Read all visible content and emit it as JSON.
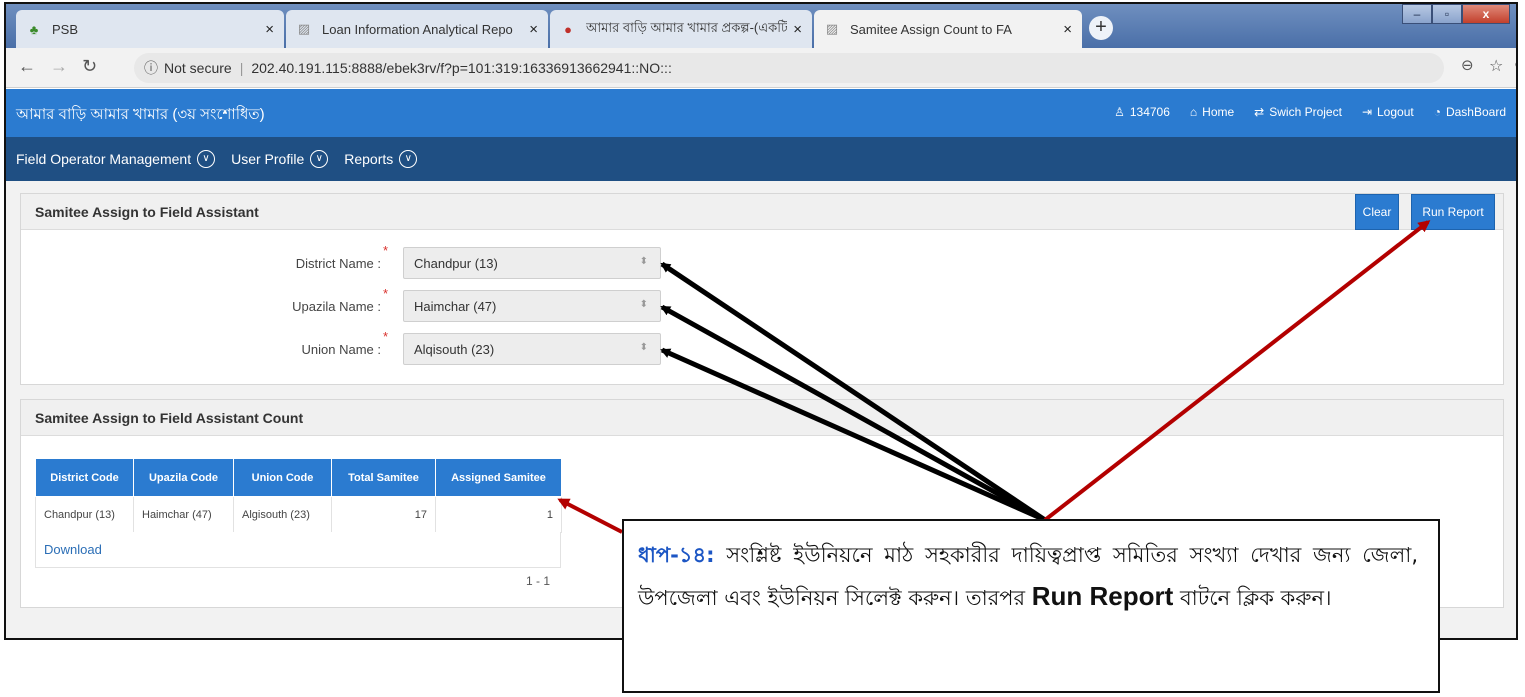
{
  "browser": {
    "tabs": [
      {
        "title": "PSB",
        "icon": "leaf-icon"
      },
      {
        "title": "Loan Information Analytical Repo",
        "icon": "page-icon"
      },
      {
        "title": "আমার বাড়ি আমার খামার প্রকল্প-(একটি",
        "icon": "emblem-icon"
      },
      {
        "title": "Samitee Assign Count to FA",
        "icon": "page-icon"
      }
    ],
    "active_tab": 3,
    "address": {
      "security": "Not secure",
      "url": "202.40.191.115:8888/ebek3rv/f?p=101:319:16336913662941::NO:::"
    }
  },
  "app": {
    "title": "আমার বাড়ি আমার খামার (৩য় সংশোধিত)",
    "user_id": "134706",
    "links": [
      "Home",
      "Swich Project",
      "Logout",
      "DashBoard"
    ],
    "menu": [
      "Field Operator Management",
      "User Profile",
      "Reports"
    ],
    "colors": {
      "header": "#2b7bd0",
      "nav": "#1f4f83",
      "button": "#2b7bd0"
    }
  },
  "form_region": {
    "title": "Samitee Assign to Field Assistant",
    "clear_label": "Clear",
    "run_label": "Run Report",
    "fields": [
      {
        "label": "District Name :",
        "value": "Chandpur (13)",
        "required": "*"
      },
      {
        "label": "Upazila Name :",
        "value": "Haimchar (47)",
        "required": "*"
      },
      {
        "label": "Union Name :",
        "value": "Alqisouth (23)",
        "required": "*"
      }
    ]
  },
  "report_region": {
    "title": "Samitee Assign to Field Assistant Count",
    "columns": [
      "District Code",
      "Upazila Code",
      "Union Code",
      "Total Samitee",
      "Assigned Samitee"
    ],
    "rows": [
      [
        "Chandpur (13)",
        "Haimchar (47)",
        "Algisouth (23)",
        "17",
        "1"
      ]
    ],
    "download_label": "Download",
    "pagination": "1 - 1"
  },
  "callout": {
    "step": "ধাপ-১৪:",
    "text_1": " সংশ্লিষ্ট ইউনিয়নে মাঠ সহকারীর দায়িত্বপ্রাপ্ত সমিতির সংখ্যা দেখার জন্য জেলা, উপজেলা এবং ইউনিয়ন সিলেক্ট করুন। তারপর ",
    "button_ref": "Run Report",
    "text_2": " বাটনে ক্লিক করুন।",
    "arrow_colors": {
      "black": "#000000",
      "red": "#b30000"
    }
  }
}
